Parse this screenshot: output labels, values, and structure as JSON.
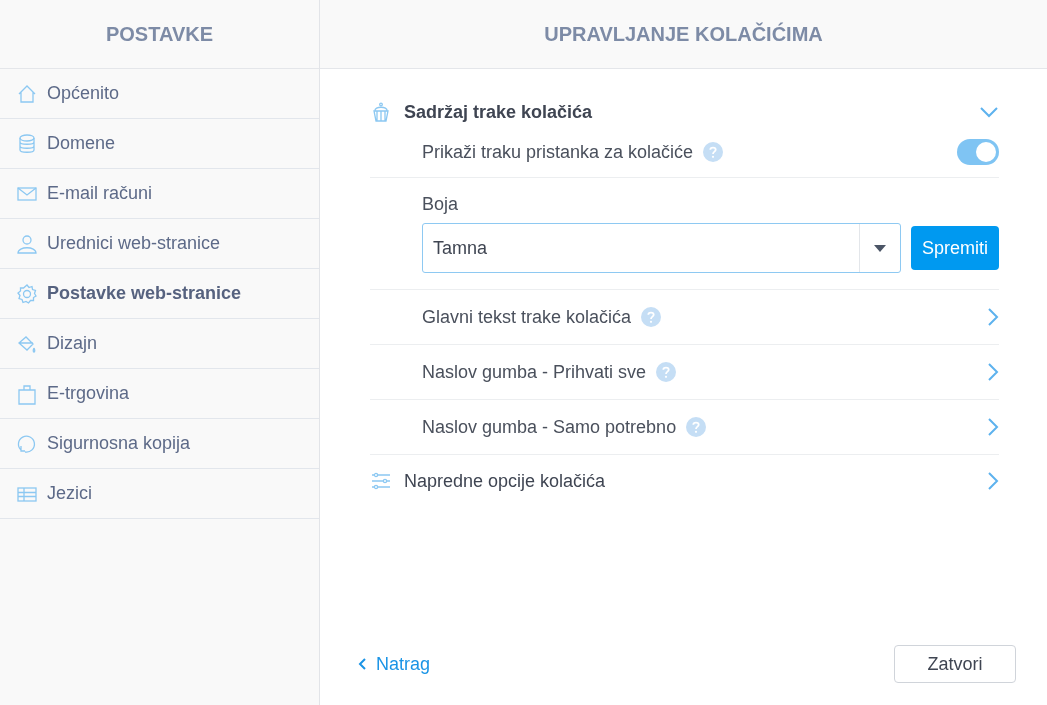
{
  "sidebar": {
    "title": "POSTAVKE",
    "items": [
      {
        "label": "Općenito",
        "selected": false
      },
      {
        "label": "Domene",
        "selected": false
      },
      {
        "label": "E-mail računi",
        "selected": false
      },
      {
        "label": "Urednici web-stranice",
        "selected": false
      },
      {
        "label": "Postavke web-stranice",
        "selected": true
      },
      {
        "label": "Dizajn",
        "selected": false
      },
      {
        "label": "E-trgovina",
        "selected": false
      },
      {
        "label": "Sigurnosna kopija",
        "selected": false
      },
      {
        "label": "Jezici",
        "selected": false
      }
    ]
  },
  "main": {
    "title": "UPRAVLJANJE KOLAČIĆIMA",
    "sections": [
      {
        "title": "Sadržaj trake kolačića",
        "expanded": true,
        "rows": [
          {
            "kind": "toggle",
            "label": "Prikaži traku pristanka za kolačiće",
            "on": true
          },
          {
            "kind": "select",
            "label": "Boja",
            "value": "Tamna",
            "button": "Spremiti"
          },
          {
            "kind": "link",
            "label": "Glavni tekst trake kolačića"
          },
          {
            "kind": "link",
            "label": "Naslov gumba - Prihvati sve"
          },
          {
            "kind": "link",
            "label": "Naslov gumba - Samo potrebno"
          }
        ]
      },
      {
        "title": "Napredne opcije kolačića",
        "expanded": false
      }
    ]
  },
  "footer": {
    "back": "Natrag",
    "close": "Zatvori"
  }
}
